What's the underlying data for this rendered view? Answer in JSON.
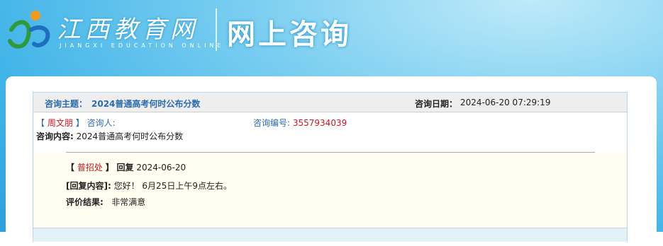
{
  "header": {
    "site_name": "江西教育网",
    "site_subtitle": "JIANGXI EDUCATION ONLINE",
    "section_title": "网上咨询"
  },
  "consult": {
    "topic_label": "咨询主题：",
    "topic": "2024普通高考何时公布分数",
    "date_label": "咨询日期：",
    "date": "2024-06-20 07:29:19",
    "bracket_open": "【",
    "bracket_close": "】",
    "user": "周文朋",
    "asker_label": "咨询人:",
    "serial_label": "咨询编号:",
    "serial": "3557934039",
    "content_label": "咨询内容:",
    "content": "2024普通高考何时公布分数"
  },
  "reply": {
    "bracket_open": "【",
    "bracket_close": "】",
    "replier": "普招处",
    "reply_label": "回复",
    "reply_date": "2024-06-20",
    "content_label": "[回复内容]:",
    "content": "您好！ 6月25日上午9点左右。",
    "eval_label": "评价结果:",
    "eval_value": "非常满意"
  },
  "colors": {
    "accent_blue": "#2a6ab0",
    "accent_red": "#d0141c",
    "banner": "#3fb3e8"
  }
}
